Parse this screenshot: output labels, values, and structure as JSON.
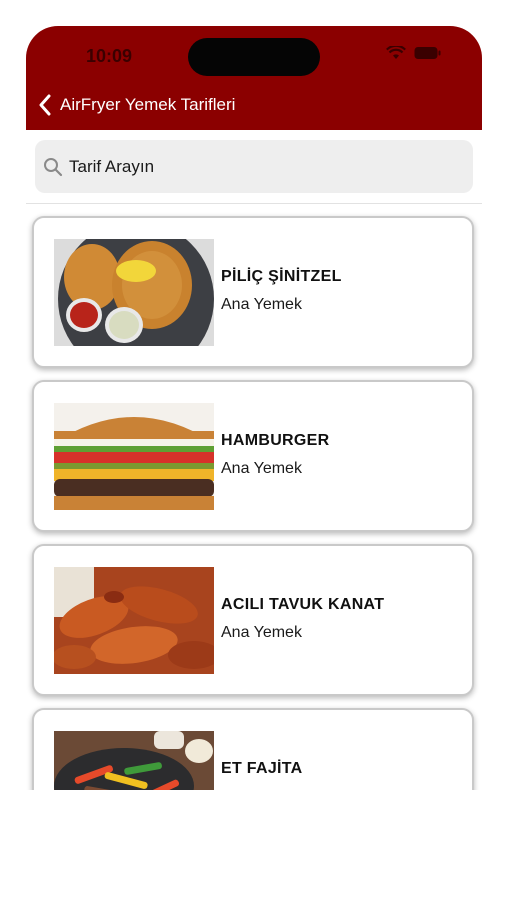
{
  "status": {
    "time": "10:09"
  },
  "nav": {
    "back_title": "AirFryer Yemek Tarifleri"
  },
  "search": {
    "placeholder": "Tarif Arayın"
  },
  "recipes": [
    {
      "title": "PİLİÇ ŞİNİTZEL",
      "category": "Ana Yemek",
      "image": "schnitzel-photo"
    },
    {
      "title": "HAMBURGER",
      "category": "Ana Yemek",
      "image": "hamburger-photo"
    },
    {
      "title": "ACILI TAVUK KANAT",
      "category": "Ana Yemek",
      "image": "chicken-wings-photo"
    },
    {
      "title": "ET FAJİTA",
      "category": "",
      "image": "fajita-photo"
    }
  ],
  "colors": {
    "header": "#8b0000",
    "search_bg": "#eeeeee"
  }
}
